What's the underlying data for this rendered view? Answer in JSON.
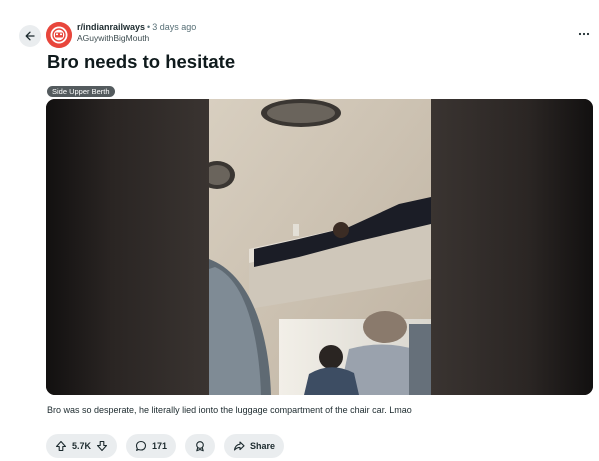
{
  "post": {
    "subreddit": "r/indianrailways",
    "separator": "•",
    "time": "3 days ago",
    "author": "AGuywithBigMouth",
    "title": "Bro needs to hesitate",
    "flair": "Side Upper Berth",
    "caption": "Bro was so desperate, he literally lied ionto the luggage compartment of the chair car. Lmao"
  },
  "actions": {
    "upvotes": "5.7K",
    "comments": "171",
    "share_label": "Share"
  },
  "icons": {
    "back": "arrow-left-icon",
    "more": "more-horizontal-icon",
    "upvote": "arrow-up-icon",
    "downvote": "arrow-down-icon",
    "comment": "comment-icon",
    "award": "award-icon",
    "share": "share-icon"
  },
  "colors": {
    "subreddit_avatar": "#e8463c",
    "pill_bg": "#eaedef",
    "flair_bg": "#545b5e"
  }
}
